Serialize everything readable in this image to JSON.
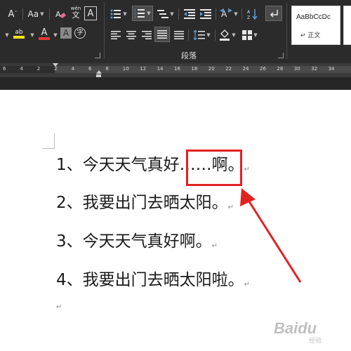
{
  "ribbon": {
    "font_size_btn": "Aa",
    "phonetic_label": "wén",
    "char_border_label": "A",
    "text_effects_label": "A",
    "font_color_label": "A",
    "shading_label": "A",
    "circle_label": "字",
    "highlight_label": "ab",
    "group_paragraph_label": "段落",
    "style_preview": "AaBbCcDc",
    "style_name": "正文"
  },
  "ruler": {
    "ticks": [
      "6",
      "4",
      "2",
      "2",
      "4",
      "6",
      "8",
      "10",
      "12",
      "14",
      "16",
      "18",
      "20",
      "22",
      "24",
      "26",
      "28",
      "30",
      "32",
      "34"
    ]
  },
  "document": {
    "paragraphs": [
      "1、今天天气真好……啊。",
      "2、我要出门去晒太阳。",
      "3、今天天气真好啊。",
      "4、我要出门去晒太阳啦。"
    ],
    "paragraph_mark": "↵"
  },
  "watermark": {
    "brand": "Baidu",
    "sub": "经验"
  },
  "colors": {
    "ribbon_bg": "#2b2b2b",
    "highlight_red": "#e32222",
    "font_color_red": "#e53935",
    "highlight_yellow": "#f5e31b"
  }
}
